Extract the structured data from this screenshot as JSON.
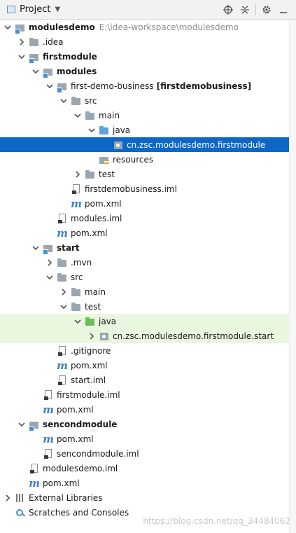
{
  "header": {
    "title": "Project",
    "dropdown_icon": "chevron-down-icon",
    "tools": [
      "locate-icon",
      "collapse-icon",
      "gear-icon",
      "hide-icon"
    ]
  },
  "tree": [
    {
      "label": "modulesdemo",
      "extra": "E:\\idea-workspace\\modulesdemo",
      "icon": "module",
      "indent": 0,
      "arrow": "down",
      "bold": true
    },
    {
      "label": ".idea",
      "icon": "folder",
      "indent": 1,
      "arrow": "right"
    },
    {
      "label": "firstmodule",
      "icon": "module",
      "indent": 1,
      "arrow": "down",
      "bold": true
    },
    {
      "label": "modules",
      "icon": "module",
      "indent": 2,
      "arrow": "down",
      "bold": true
    },
    {
      "label": "first-demo-business",
      "extra": "[firstdemobusiness]",
      "extra_bold": true,
      "icon": "module",
      "indent": 3,
      "arrow": "down"
    },
    {
      "label": "src",
      "icon": "folder",
      "indent": 4,
      "arrow": "down"
    },
    {
      "label": "main",
      "icon": "folder",
      "indent": 5,
      "arrow": "down"
    },
    {
      "label": "java",
      "icon": "folder src",
      "indent": 6,
      "arrow": "down"
    },
    {
      "label": "cn.zsc.modulesdemo.firstmodule",
      "icon": "pkg",
      "indent": 7,
      "arrow": "none",
      "selected": true
    },
    {
      "label": "resources",
      "icon": "res",
      "indent": 6,
      "arrow": "none"
    },
    {
      "label": "test",
      "icon": "folder",
      "indent": 5,
      "arrow": "right"
    },
    {
      "label": "firstdemobusiness.iml",
      "icon": "file",
      "indent": 4,
      "arrow": "none"
    },
    {
      "label": "pom.xml",
      "icon": "mvn",
      "indent": 4,
      "arrow": "none"
    },
    {
      "label": "modules.iml",
      "icon": "file",
      "indent": 3,
      "arrow": "none"
    },
    {
      "label": "pom.xml",
      "icon": "mvn",
      "indent": 3,
      "arrow": "none"
    },
    {
      "label": "start",
      "icon": "module",
      "indent": 2,
      "arrow": "down",
      "bold": true
    },
    {
      "label": ".mvn",
      "icon": "folder",
      "indent": 3,
      "arrow": "right"
    },
    {
      "label": "src",
      "icon": "folder",
      "indent": 3,
      "arrow": "down"
    },
    {
      "label": "main",
      "icon": "folder",
      "indent": 4,
      "arrow": "right"
    },
    {
      "label": "test",
      "icon": "folder",
      "indent": 4,
      "arrow": "down"
    },
    {
      "label": "java",
      "icon": "folder test",
      "indent": 5,
      "arrow": "down",
      "highlight": true
    },
    {
      "label": "cn.zsc.modulesdemo.firstmodule.start",
      "icon": "pkg",
      "indent": 6,
      "arrow": "right",
      "highlight": true
    },
    {
      "label": ".gitignore",
      "icon": "file",
      "indent": 3,
      "arrow": "none"
    },
    {
      "label": "pom.xml",
      "icon": "mvn",
      "indent": 3,
      "arrow": "none"
    },
    {
      "label": "start.iml",
      "icon": "file",
      "indent": 3,
      "arrow": "none"
    },
    {
      "label": "firstmodule.iml",
      "icon": "file",
      "indent": 2,
      "arrow": "none"
    },
    {
      "label": "pom.xml",
      "icon": "mvn",
      "indent": 2,
      "arrow": "none"
    },
    {
      "label": "sencondmodule",
      "icon": "module",
      "indent": 1,
      "arrow": "down",
      "bold": true
    },
    {
      "label": "pom.xml",
      "icon": "mvn",
      "indent": 2,
      "arrow": "none"
    },
    {
      "label": "sencondmodule.iml",
      "icon": "file",
      "indent": 2,
      "arrow": "none"
    },
    {
      "label": "modulesdemo.iml",
      "icon": "file",
      "indent": 1,
      "arrow": "none"
    },
    {
      "label": "pom.xml",
      "icon": "mvn",
      "indent": 1,
      "arrow": "none"
    },
    {
      "label": "External Libraries",
      "icon": "libs",
      "indent": 0,
      "arrow": "right"
    },
    {
      "label": "Scratches and Consoles",
      "icon": "scratch",
      "indent": 0,
      "arrow": "none"
    }
  ],
  "watermark": "https://blog.csdn.net/qq_34484062",
  "colors": {
    "selection": "#0d67c6",
    "highlight": "#eaf7df",
    "source_root": "#5ea3d9",
    "test_root": "#6bbf59"
  }
}
